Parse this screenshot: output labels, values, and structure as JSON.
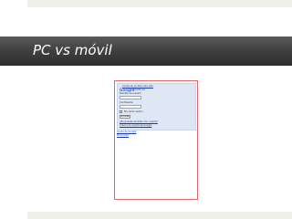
{
  "slide": {
    "title": "PC vs móvil"
  },
  "mobile_login": {
    "header": "Continuar en Bloconto sitio",
    "logo": "Google",
    "account_caption": "Cuenta de",
    "account_caption2": "Nombre de usuario",
    "password_label": "Contraseña",
    "remember_label": "No cerrar sesión",
    "signin_button": "Acceder",
    "cant_access": "¿No puedes acceder a tu cuenta?",
    "create_account": "Crear una cuenta de Google",
    "help": "Ayuda de Google",
    "privacy": "Privacidad"
  }
}
